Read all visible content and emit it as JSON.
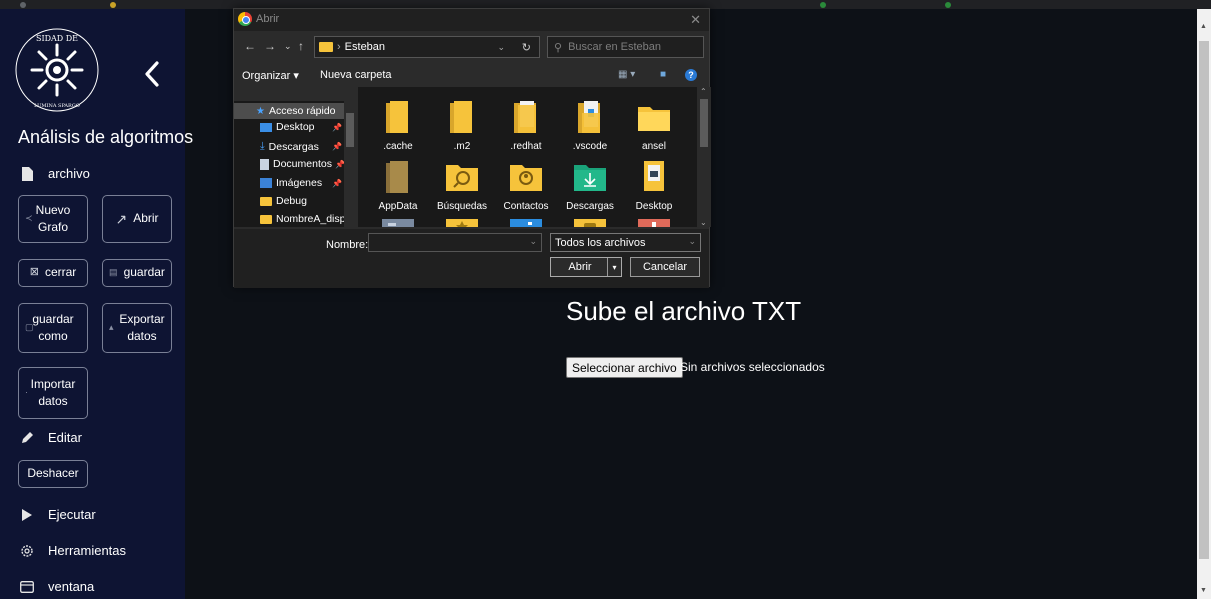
{
  "sidebar": {
    "app_title": "Análisis de algoritmos",
    "menu": {
      "archivo": "archivo",
      "editar": "Editar",
      "ejecutar": "Ejecutar",
      "herramientas": "Herramientas",
      "ventana": "ventana"
    },
    "buttons": {
      "nuevo_grafo": "Nuevo Grafo",
      "abrir": "Abrir",
      "cerrar": "cerrar",
      "guardar": "guardar",
      "guardar_como": "guardar como",
      "exportar_datos": "Exportar datos",
      "importar_datos": "Importar datos",
      "deshacer": "Deshacer"
    }
  },
  "main": {
    "title": "Sube el archivo TXT",
    "file_button": "Seleccionar archivo",
    "file_status": "Sin archivos seleccionados"
  },
  "dialog": {
    "title": "Abrir",
    "path_folder": "Esteban",
    "search_placeholder": "Buscar en Esteban",
    "toolbar": {
      "organizar": "Organizar ▾",
      "nueva_carpeta": "Nueva carpeta"
    },
    "tree": [
      {
        "label": "Acceso rápido",
        "icon": "star-icon"
      },
      {
        "label": "Desktop",
        "icon": "desktop-folder-icon"
      },
      {
        "label": "Descargas",
        "icon": "download-icon"
      },
      {
        "label": "Documentos",
        "icon": "documents-icon"
      },
      {
        "label": "Imágenes",
        "icon": "pictures-icon"
      },
      {
        "label": "Debug",
        "icon": "folder-icon"
      },
      {
        "label": "NombreA_displa",
        "icon": "folder-icon"
      }
    ],
    "files": [
      {
        "label": ".cache"
      },
      {
        "label": ".m2"
      },
      {
        "label": ".redhat"
      },
      {
        "label": ".vscode"
      },
      {
        "label": "ansel"
      },
      {
        "label": "AppData"
      },
      {
        "label": "Búsquedas"
      },
      {
        "label": "Contactos"
      },
      {
        "label": "Descargas"
      },
      {
        "label": "Desktop"
      }
    ],
    "name_label": "Nombre:",
    "name_value": "",
    "file_type": "Todos los archivos",
    "open_button": "Abrir",
    "cancel_button": "Cancelar"
  },
  "colors": {
    "sidebar_bg": "#0e1433",
    "page_bg": "#0d1117",
    "folder_yellow": "#f6c33b"
  }
}
